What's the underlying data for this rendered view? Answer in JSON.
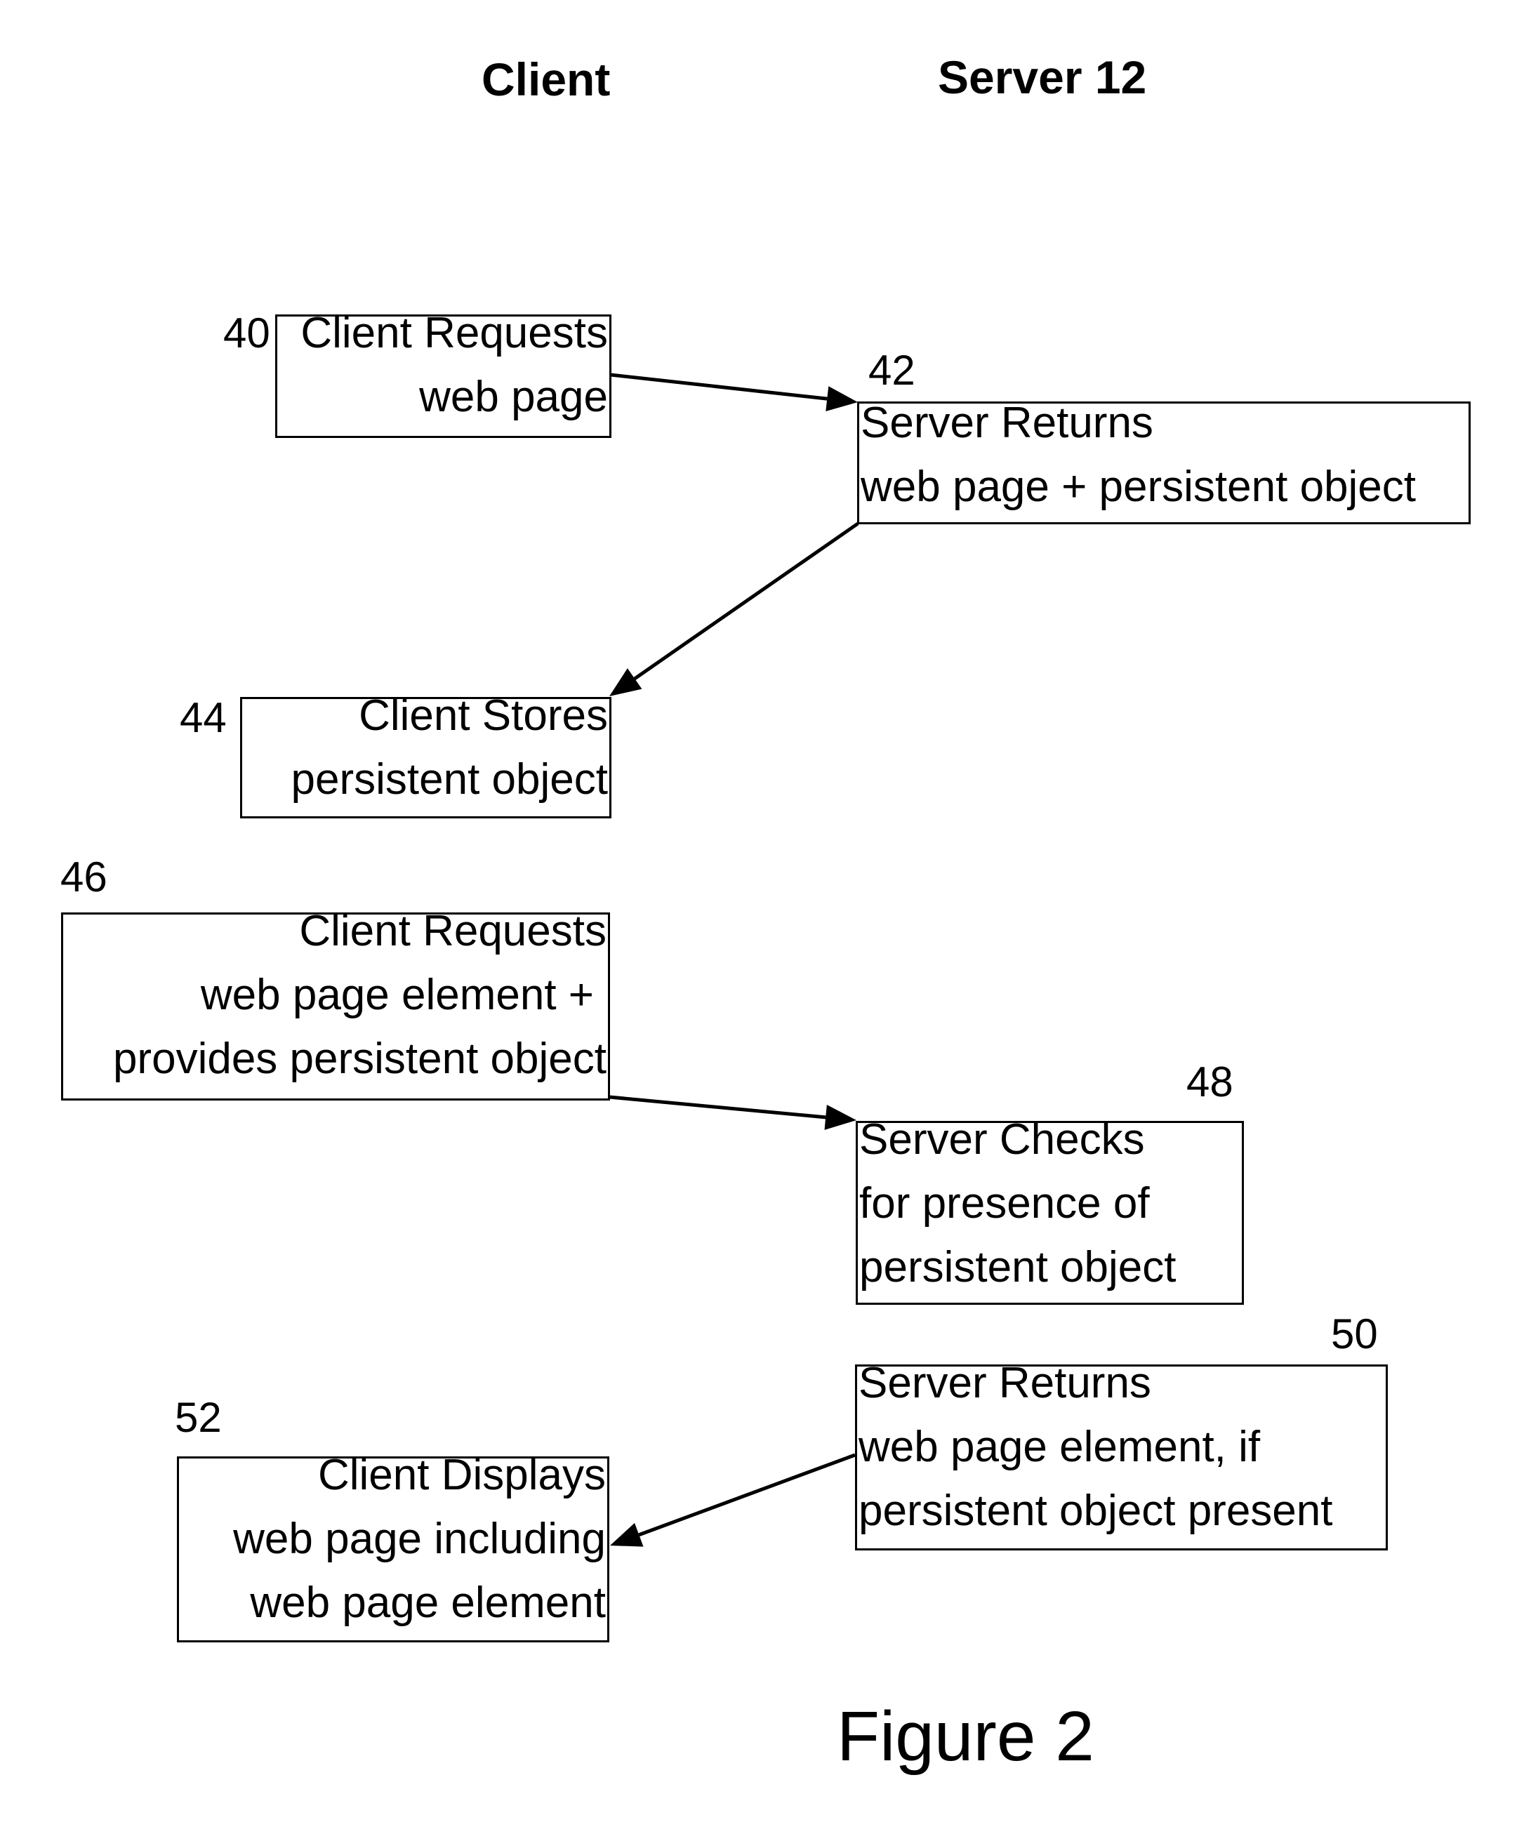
{
  "headers": {
    "client": "Client",
    "server": "Server 12"
  },
  "steps": [
    {
      "ref": "40",
      "lines": [
        "Client Requests",
        "web page"
      ],
      "column": "client"
    },
    {
      "ref": "42",
      "lines": [
        "Server Returns",
        "web page + persistent object"
      ],
      "column": "server"
    },
    {
      "ref": "44",
      "lines": [
        "Client Stores",
        "persistent object"
      ],
      "column": "client"
    },
    {
      "ref": "46",
      "lines": [
        "Client Requests",
        "web page element +",
        "provides persistent object"
      ],
      "column": "client"
    },
    {
      "ref": "48",
      "lines": [
        "Server Checks",
        "for presence of",
        "persistent object"
      ],
      "column": "server"
    },
    {
      "ref": "50",
      "lines": [
        "Server Returns",
        "web page element, if",
        "persistent object present"
      ],
      "column": "server"
    },
    {
      "ref": "52",
      "lines": [
        "Client Displays",
        "web page including",
        "web page element"
      ],
      "column": "client"
    }
  ],
  "arrows": [
    {
      "from": "40",
      "to": "42"
    },
    {
      "from": "42",
      "to": "44"
    },
    {
      "from": "46",
      "to": "48"
    },
    {
      "from": "50",
      "to": "52"
    }
  ],
  "figure_label": "Figure 2"
}
